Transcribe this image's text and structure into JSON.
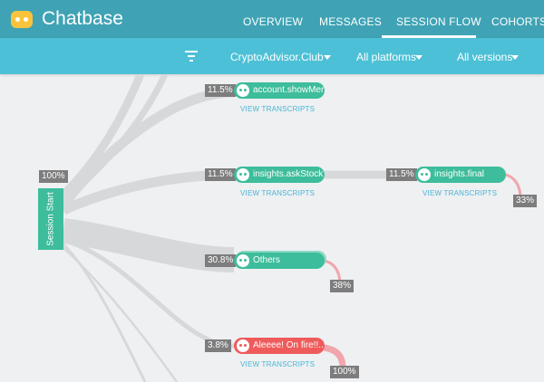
{
  "app": {
    "name": "Chatbase",
    "logo_icon": "chatbot-face-icon"
  },
  "tabs": [
    {
      "label": "OVERVIEW",
      "active": false
    },
    {
      "label": "MESSAGES",
      "active": false
    },
    {
      "label": "SESSION FLOW",
      "active": true
    },
    {
      "label": "COHORTS",
      "active": false
    }
  ],
  "filters": {
    "bot": "CryptoAdvisor.Club",
    "platform": "All platforms",
    "version": "All versions"
  },
  "flow": {
    "start": {
      "label": "Session Start",
      "pct": "100%"
    },
    "nodes": [
      {
        "label": "account.showMenu",
        "pct": "11.5%",
        "link": "VIEW TRANSCRIPTS"
      },
      {
        "label": "insights.askStock",
        "pct": "11.5%",
        "link": "VIEW TRANSCRIPTS"
      },
      {
        "label": "insights.final",
        "pct": "11.5%",
        "link": "VIEW TRANSCRIPTS",
        "exit_pct": "33%"
      },
      {
        "label": "Others",
        "pct": "30.8%",
        "exit_pct": "38%"
      },
      {
        "label": "Aleeee! On fire!!...",
        "pct": "3.8%",
        "link": "VIEW TRANSCRIPTS",
        "exit_pct": "100%"
      }
    ]
  },
  "colors": {
    "header": "#3fa3b5",
    "subheader": "#4cc0d6",
    "node": "#3dbd9b",
    "node_error": "#ef5b5b",
    "flow": "#d6d8da",
    "exit": "#f1a5ad",
    "link": "#4bb4d3"
  }
}
